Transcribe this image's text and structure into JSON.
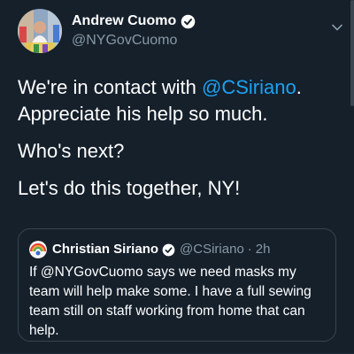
{
  "tweet": {
    "author": {
      "name": "Andrew Cuomo",
      "handle": "@NYGovCuomo",
      "avatar_icon": "profile-photo"
    },
    "paragraphs": [
      {
        "before": "We're in contact with ",
        "mention": "@CSiriano",
        "after": ". Appreciate his help so much."
      },
      {
        "text": "Who's next?"
      },
      {
        "text": "Let's do this together, NY!"
      }
    ],
    "quote": {
      "name": "Christian Siriano",
      "handle": "@CSiriano",
      "separator": "·",
      "time": "2h",
      "text": "If @NYGovCuomo says we need masks my team will help make some. I have a full sewing team still on staff working from home that can help."
    }
  },
  "colors": {
    "background": "#15202b",
    "link": "#1da1f2",
    "muted": "#8899a6",
    "border": "#38444d"
  }
}
